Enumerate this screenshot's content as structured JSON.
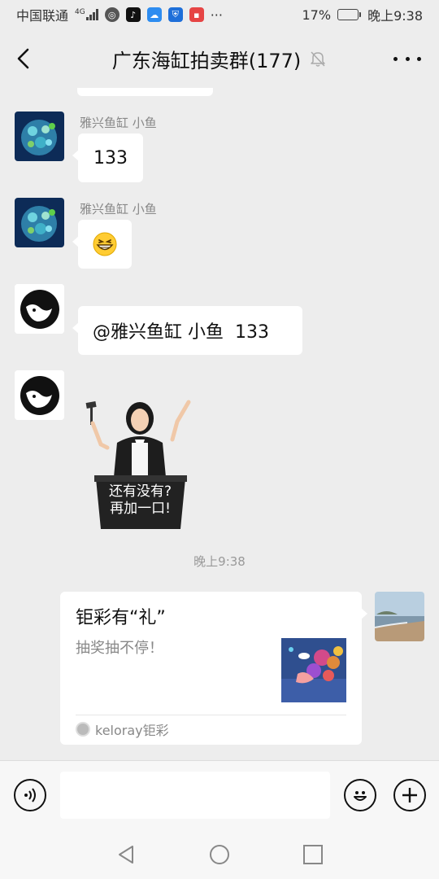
{
  "status_bar": {
    "carrier": "中国联通",
    "network_type": "4G",
    "battery_percent": "17%",
    "battery_level": 0.17,
    "time": "晚上9:38",
    "more_indicator": "···"
  },
  "nav": {
    "title": "广东海缸拍卖群(177)",
    "back_icon": "back-arrow-icon",
    "mute_icon": "bell-muted-icon",
    "more_icon": "more-dots-icon"
  },
  "messages": [
    {
      "sender": "雅兴鱼缸 小鱼",
      "text": "133"
    },
    {
      "sender": "雅兴鱼缸 小鱼",
      "emoji": "grin-emoji"
    },
    {
      "text": "@雅兴鱼缸 小鱼  133"
    },
    {
      "sticker_lines": [
        "还有没有?",
        "再加一口!"
      ]
    }
  ],
  "timestamp": "晚上9:38",
  "card": {
    "title": "钜彩有“礼”",
    "description": "抽奖抽不停！",
    "source": "keloray钜彩"
  },
  "input_bar": {
    "voice_icon": "voice-icon",
    "emoji_icon": "emoji-smile-icon",
    "add_icon": "plus-icon",
    "input_value": ""
  },
  "system_nav": {
    "back_icon": "triangle-back-icon",
    "home_icon": "circle-home-icon",
    "recents_icon": "square-recents-icon"
  },
  "colors": {
    "background": "#ededed",
    "bubble": "#ffffff",
    "input_bar": "#f7f7f7",
    "battery": "#f5a623"
  }
}
